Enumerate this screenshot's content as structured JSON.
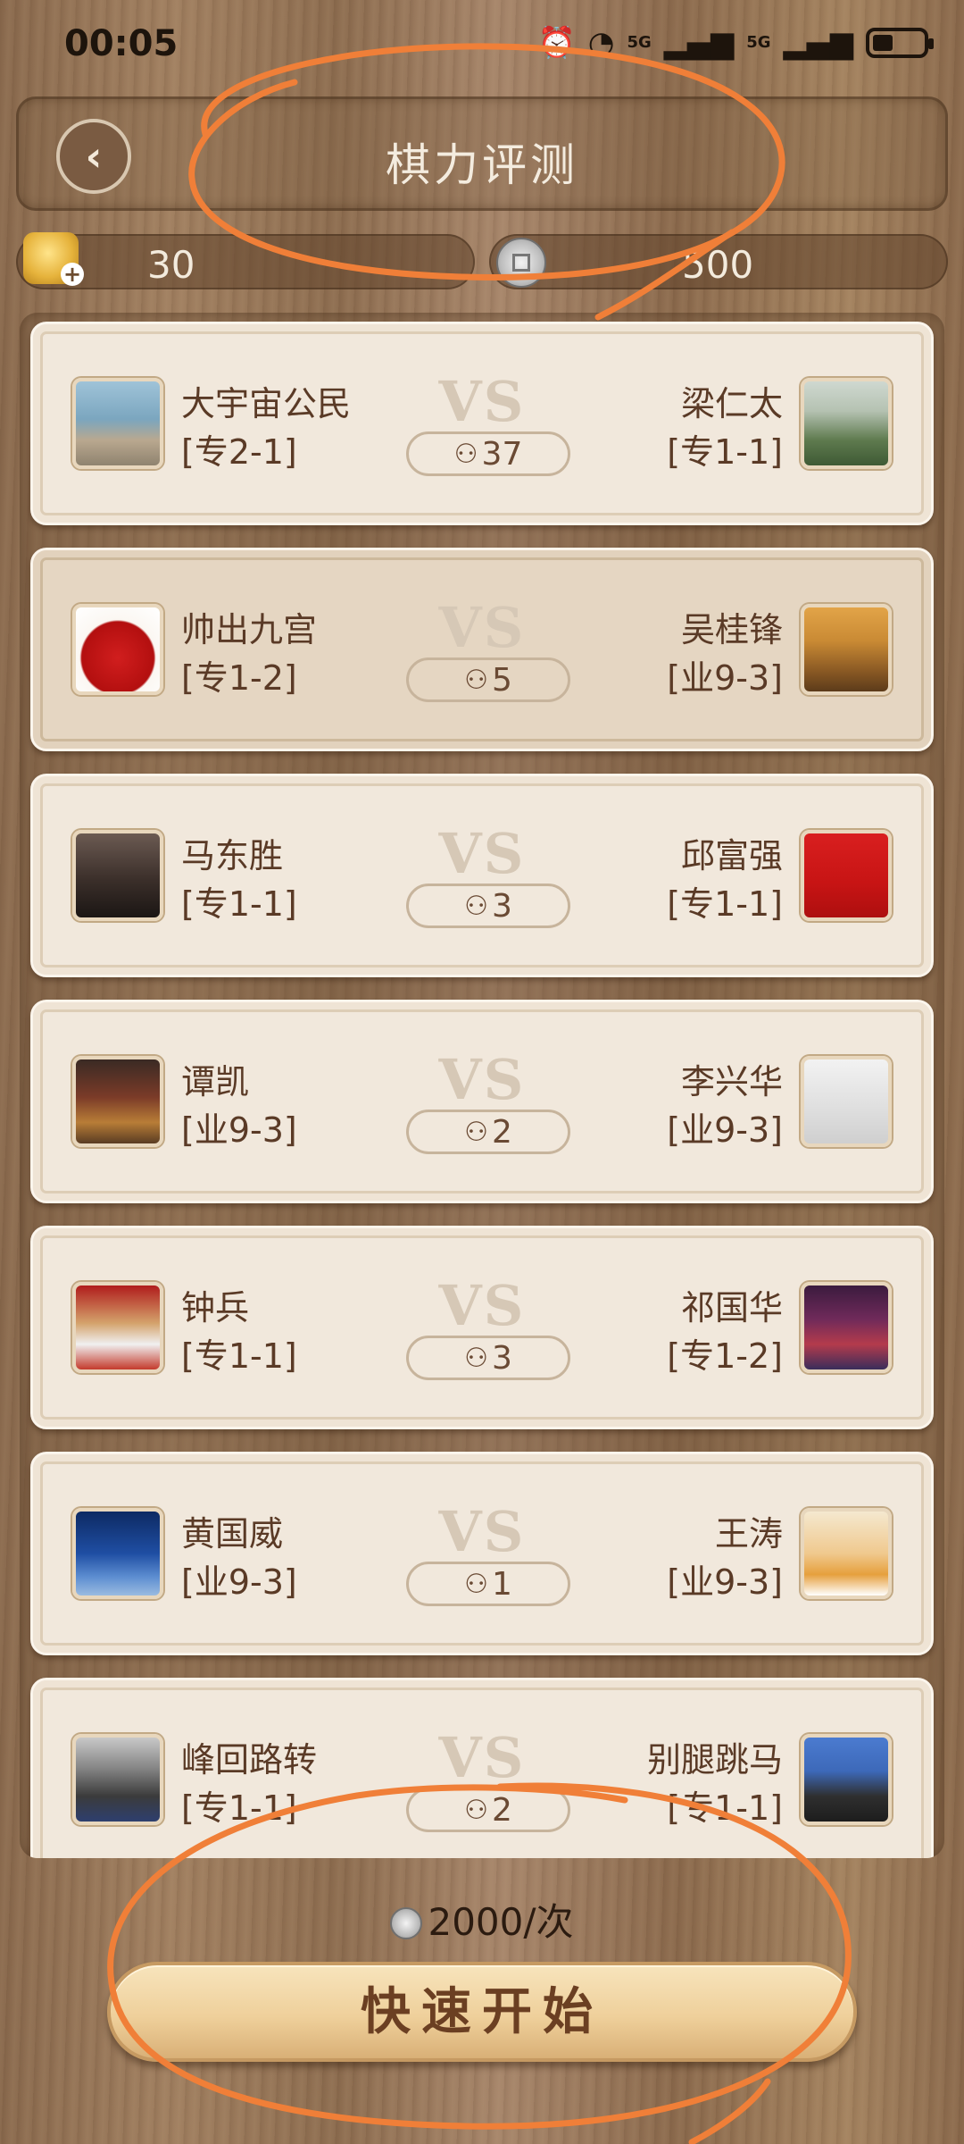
{
  "status_bar": {
    "time": "00:05",
    "icons": [
      "alarm-icon",
      "wifi-icon",
      "signal-icon",
      "signal-icon",
      "battery-icon"
    ],
    "labels": [
      "5G",
      "5G"
    ]
  },
  "header": {
    "title": "棋力评测"
  },
  "currency": {
    "gold": "30",
    "coins": "500"
  },
  "matches": [
    {
      "left": {
        "name": "大宇宙公民",
        "rank": "[专2-1]"
      },
      "right": {
        "name": "梁仁太",
        "rank": "[专1-1]"
      },
      "viewers": "37"
    },
    {
      "left": {
        "name": "帅出九宫",
        "rank": "[专1-2]"
      },
      "right": {
        "name": "吴桂锋",
        "rank": "[业9-3]"
      },
      "viewers": "5"
    },
    {
      "left": {
        "name": "马东胜",
        "rank": "[专1-1]"
      },
      "right": {
        "name": "邱富强",
        "rank": "[专1-1]"
      },
      "viewers": "3"
    },
    {
      "left": {
        "name": "谭凯",
        "rank": "[业9-3]"
      },
      "right": {
        "name": "李兴华",
        "rank": "[业9-3]"
      },
      "viewers": "2"
    },
    {
      "left": {
        "name": "钟兵",
        "rank": "[专1-1]"
      },
      "right": {
        "name": "祁国华",
        "rank": "[专1-2]"
      },
      "viewers": "3"
    },
    {
      "left": {
        "name": "黄国威",
        "rank": "[业9-3]"
      },
      "right": {
        "name": "王涛",
        "rank": "[业9-3]"
      },
      "viewers": "1"
    },
    {
      "left": {
        "name": "峰回路转",
        "rank": "[专1-1]"
      },
      "right": {
        "name": "别腿跳马",
        "rank": "[专1-1]"
      },
      "viewers": "2"
    }
  ],
  "vs_label": "VS",
  "footer": {
    "cost": "2000/次",
    "start_label": "快速开始"
  },
  "colors": {
    "annotation": "#f07f38",
    "card": "#f1e8dc",
    "text_brown": "#5a3a26",
    "button_gold": "#efd09b"
  }
}
